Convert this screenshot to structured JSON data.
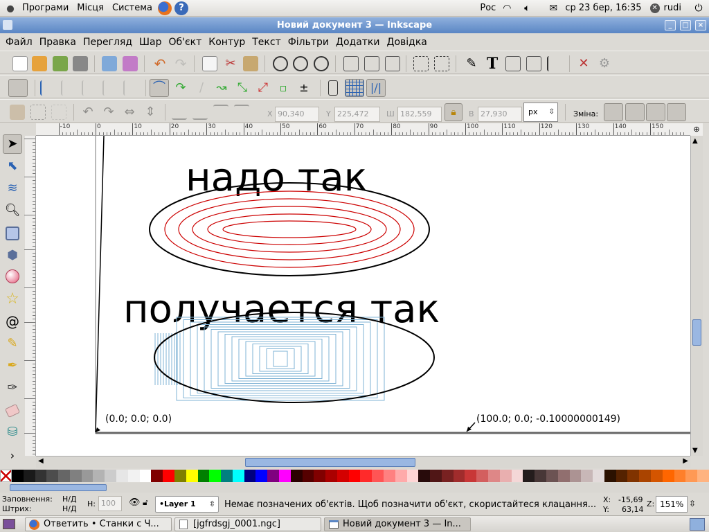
{
  "top_panel": {
    "menus": [
      "Програми",
      "Місця",
      "Система"
    ],
    "keyboard_layout": "Рос",
    "datetime": "ср 23 бер, 16:35",
    "user": "rudi"
  },
  "window": {
    "title": "Новий документ 3 — Inkscape",
    "buttons": [
      "_",
      "□",
      "×"
    ]
  },
  "menubar": [
    "Файл",
    "Правка",
    "Перегляд",
    "Шар",
    "Об'єкт",
    "Контур",
    "Текст",
    "Фільтри",
    "Додатки",
    "Довідка"
  ],
  "tool_controls": {
    "x_label": "X",
    "x_value": "90,340",
    "y_label": "Y",
    "y_value": "225,472",
    "w_label": "Ш",
    "w_value": "182,559",
    "h_label": "В",
    "h_value": "27,930",
    "unit": "px",
    "change_label": "Зміна:"
  },
  "ruler_labels": [
    "-10",
    "0",
    "10",
    "20",
    "30",
    "40",
    "50",
    "60",
    "70",
    "80",
    "90",
    "100",
    "110",
    "120",
    "130",
    "140",
    "150"
  ],
  "canvas": {
    "text_top": "надо так",
    "text_bottom": "получается так",
    "coord_left": "(0.0; 0.0; 0.0)",
    "coord_right": "(100.0; 0.0; -0.10000000149)"
  },
  "status": {
    "fill_label": "Заповнення:",
    "fill_value": "Н/Д",
    "stroke_label": "Штрих:",
    "stroke_value": "Н/Д",
    "h_label": "Н:",
    "h_value": "100",
    "layer": "•Layer 1",
    "message": "Немає позначених об'єктів. Щоб позначити об'єкт, скористайтеся клацання...",
    "x_label": "X:",
    "x_value": "-15,69",
    "y_label": "Y:",
    "y_value": "63,14",
    "z_label": "Z:",
    "zoom": "151%"
  },
  "taskbar": [
    {
      "label": "Ответить • Станки с Ч...",
      "icon": "firefox-icon"
    },
    {
      "label": "[jgfrdsgj_0001.ngc]",
      "icon": "text-file-icon"
    },
    {
      "label": "Новий документ 3 — In...",
      "icon": "inkscape-window-icon"
    }
  ],
  "colors": {
    "accent": "#5a86c4",
    "red_offsets": "#cc0000",
    "blue_offsets": "#7fb3d5"
  }
}
